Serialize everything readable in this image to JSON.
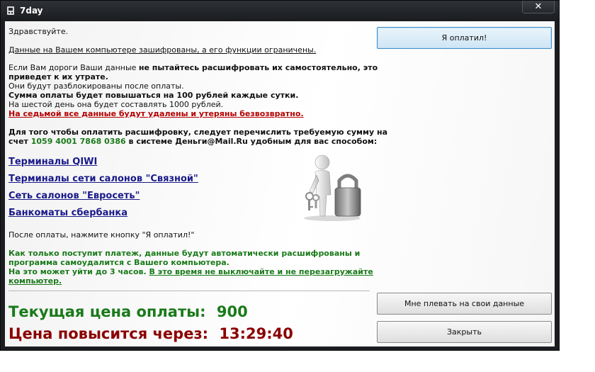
{
  "window": {
    "title": "7day",
    "close_symbol": "✕"
  },
  "content": {
    "greeting": "Здравствуйте.",
    "encrypted_notice": "Данные на Вашем компьютере зашифрованы, а его функции ограничены.",
    "p1_line1_prefix": "Если Вам дороги Ваши данные ",
    "p1_line1_bold": "не пытайтесь расшифровать их самостоятельно, это",
    "p1_line2": "приведет к их утрате.",
    "p1_line3": "Они будут разблокированы после оплаты.",
    "p1_line4": "Сумма оплаты будет повышаться на 100 рублей каждые сутки.",
    "p1_line5": "На шестой день она будет составлять 1000 рублей.",
    "p1_line6": "На седьмой все данные будут удалены и утеряны безвозвратно.",
    "pay_line1": "Для того чтобы оплатить расшифровку, следует перечислить требуемую сумму на",
    "pay_line2_prefix": "счет ",
    "pay_account": "1059 4001 7868 0386",
    "pay_line2_suffix": " в системе Деньги@Mail.Ru удобным для вас способом:",
    "after_payment": "После оплаты, нажмите кнопку \"Я оплатил!\"",
    "auto_line1": "Как только поступит платеж, данные будут автоматически расшифрованы и",
    "auto_line2": "программа самоудалится с Вашего компьютера.",
    "auto_line3_prefix": "На это может уйти до 3 часов. ",
    "auto_line3_underlined": "В это время не выключайте и не перезагружайте",
    "auto_line4": "компьютер."
  },
  "links": [
    {
      "label": "Терминалы QIWI"
    },
    {
      "label": "Терминалы сети салонов \"Связной\""
    },
    {
      "label": "Сеть салонов \"Евросеть\""
    },
    {
      "label": "Банкоматы сбербанка"
    }
  ],
  "price": {
    "current_label": "Текущая цена оплаты:",
    "current_value": "900",
    "timer_label": "Цена повысится через:",
    "timer_value": "13:29:40"
  },
  "buttons": {
    "paid": "Я оплатил!",
    "dont_care": "Мне плевать на свои данные",
    "close": "Закрыть"
  },
  "colors": {
    "green": "#1a7a1a",
    "red": "#8b0000",
    "link": "#1a1a8a",
    "warning_red": "#b40000"
  },
  "icons": {
    "window_icon": "app-icon",
    "illustration": "person-with-padlock-and-key"
  }
}
